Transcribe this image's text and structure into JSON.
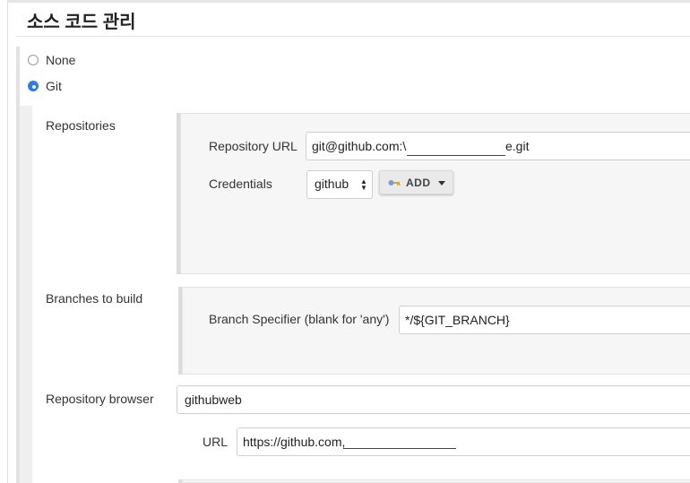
{
  "section": {
    "title": "소스 코드 관리"
  },
  "scm": {
    "none_label": "None",
    "git_label": "Git",
    "selected": "Git"
  },
  "repositories": {
    "label": "Repositories",
    "url_label": "Repository URL",
    "url_prefix": "git@github.com:\\",
    "url_suffix": "e.git",
    "credentials_label": "Credentials",
    "credentials_value": "github",
    "add_button": "ADD"
  },
  "branches": {
    "label": "Branches to build",
    "specifier_label": "Branch Specifier (blank for 'any')",
    "specifier_value": "*/${GIT_BRANCH}"
  },
  "browser": {
    "label": "Repository browser",
    "value": "githubweb",
    "url_label": "URL",
    "url_value": "https://github.com,"
  },
  "icons": {
    "key": "key-icon",
    "dropdown": "caret-down-icon",
    "select": "select-arrows-icon"
  },
  "colors": {
    "accent": "#2d7de0",
    "panel": "#f6f6f6"
  }
}
